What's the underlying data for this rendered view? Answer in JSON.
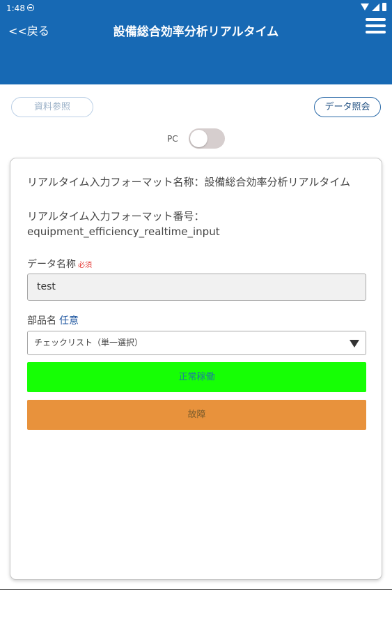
{
  "status_bar": {
    "time": "1:48"
  },
  "header": {
    "back_label": "<<戻る",
    "title": "設備総合効率分析リアルタイム"
  },
  "toolbar": {
    "reference_button": "資料参照",
    "data_query_button": "データ照会",
    "toggle_label": "PC",
    "toggle_on": false
  },
  "form": {
    "format_name_text": "リアルタイム入力フォーマット名称：設備総合効率分析リアルタイム",
    "format_number_label": "リアルタイム入力フォーマット番号：",
    "format_number_value": "equipment_efficiency_realtime_input",
    "data_name_label": "データ名称",
    "required_tag": "必須",
    "data_name_value": "test",
    "part_name_label": "部品名",
    "optional_tag": "任意",
    "part_select_value": "チェックリスト（単一選択）",
    "normal_button": "正常稼働",
    "fault_button": "故障"
  },
  "colors": {
    "header_bg": "#1769b4",
    "normal_button": "#16ff05",
    "fault_button": "#e8923c",
    "required_tag": "#e53935",
    "optional_tag": "#1e56a0"
  }
}
